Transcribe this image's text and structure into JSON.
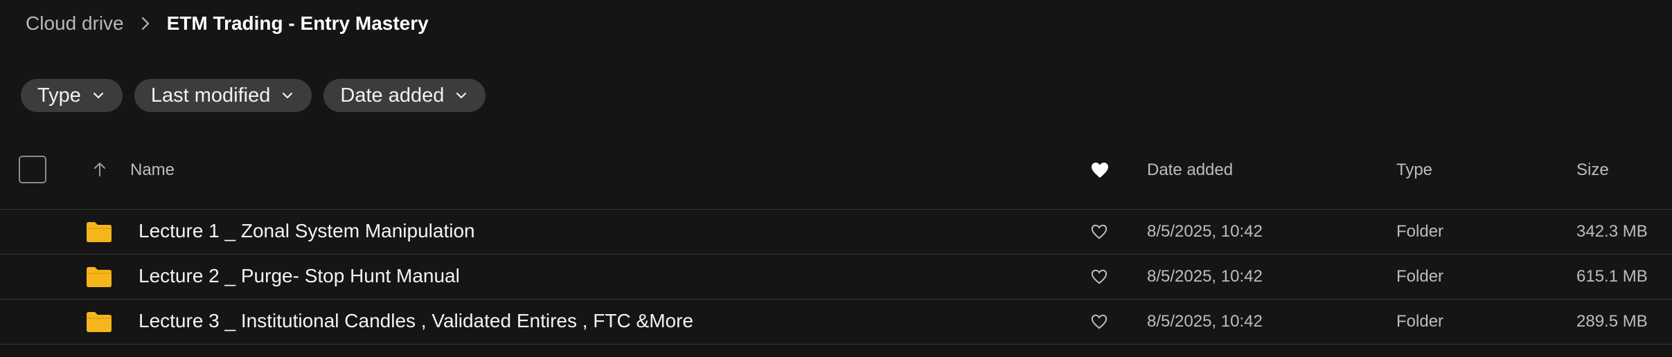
{
  "breadcrumb": {
    "root": "Cloud drive",
    "current": "ETM Trading - Entry Mastery"
  },
  "filters": [
    {
      "label": "Type"
    },
    {
      "label": "Last modified"
    },
    {
      "label": "Date added"
    }
  ],
  "table": {
    "columns": {
      "name": "Name",
      "date_added": "Date added",
      "type": "Type",
      "size": "Size"
    },
    "rows": [
      {
        "name": "Lecture 1 _ Zonal System Manipulation",
        "date_added": "8/5/2025, 10:42",
        "type": "Folder",
        "size": "342.3 MB"
      },
      {
        "name": "Lecture 2 _ Purge- Stop Hunt Manual",
        "date_added": "8/5/2025, 10:42",
        "type": "Folder",
        "size": "615.1 MB"
      },
      {
        "name": "Lecture 3 _ Institutional Candles , Validated Entires , FTC &More",
        "date_added": "8/5/2025, 10:42",
        "type": "Folder",
        "size": "289.5 MB"
      }
    ]
  },
  "colors": {
    "background": "#141514",
    "chip": "#3b3c3c",
    "folder": "#f5b51b",
    "divider": "#343535"
  },
  "icons": {
    "breadcrumb_separator": "chevron-right-icon",
    "chip_dropdown": "chevron-down-icon",
    "sort": "arrow-up-icon",
    "favorites_header": "heart-filled-icon",
    "row_favorite": "heart-outline-icon",
    "row_type": "folder-icon"
  }
}
